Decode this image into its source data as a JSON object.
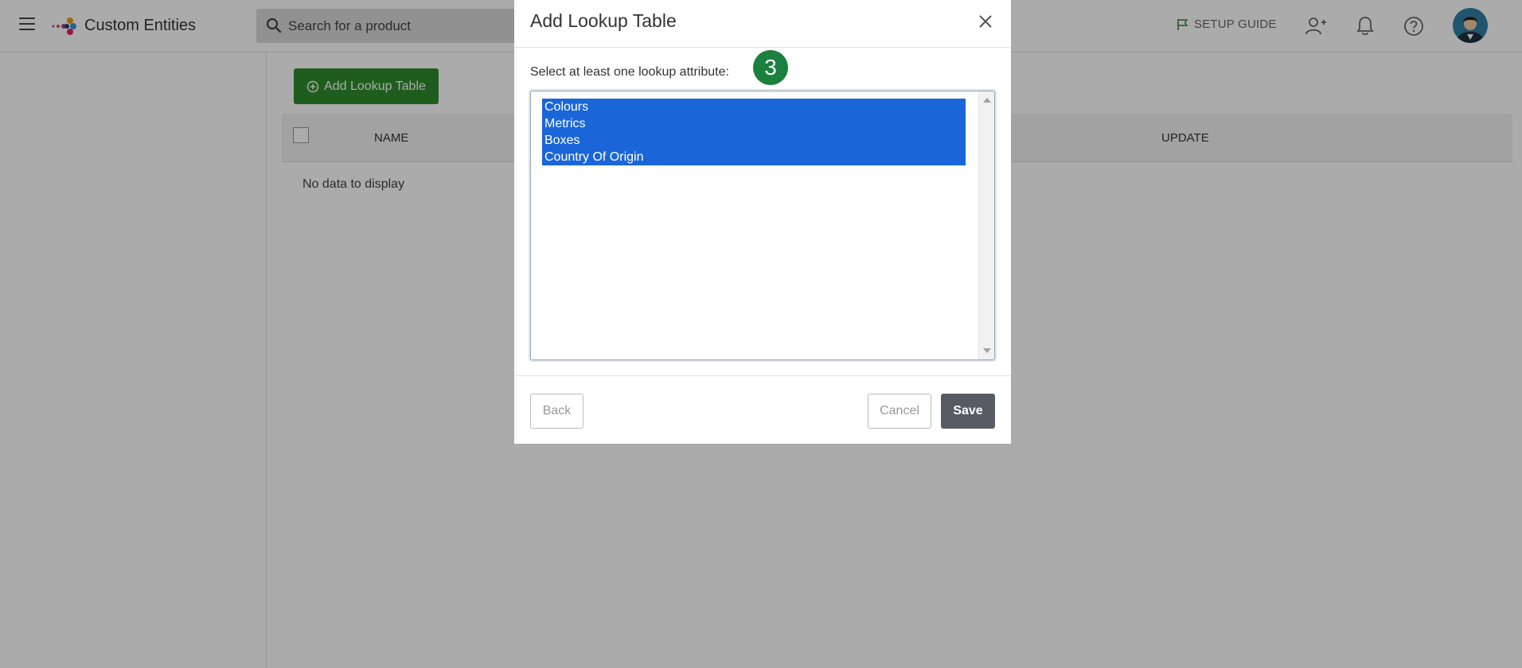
{
  "header": {
    "app_title": "Custom Entities",
    "search_placeholder": "Search for a product",
    "setup_guide_label": "SETUP GUIDE"
  },
  "page": {
    "add_button_label": "Add Lookup Table",
    "columns": [
      "NAME",
      "UPDATE"
    ],
    "empty_message": "No data to display"
  },
  "modal": {
    "title": "Add Lookup Table",
    "prompt": "Select at least one lookup attribute:",
    "step_number": "3",
    "options": [
      "Colours",
      "Metrics",
      "Boxes",
      "Country Of Origin"
    ],
    "back_label": "Back",
    "cancel_label": "Cancel",
    "save_label": "Save"
  },
  "colors": {
    "primary_green": "#2e8b2e",
    "step_badge": "#1b7f3e",
    "selection_blue": "#1a66d9",
    "save_button": "#555c63"
  }
}
